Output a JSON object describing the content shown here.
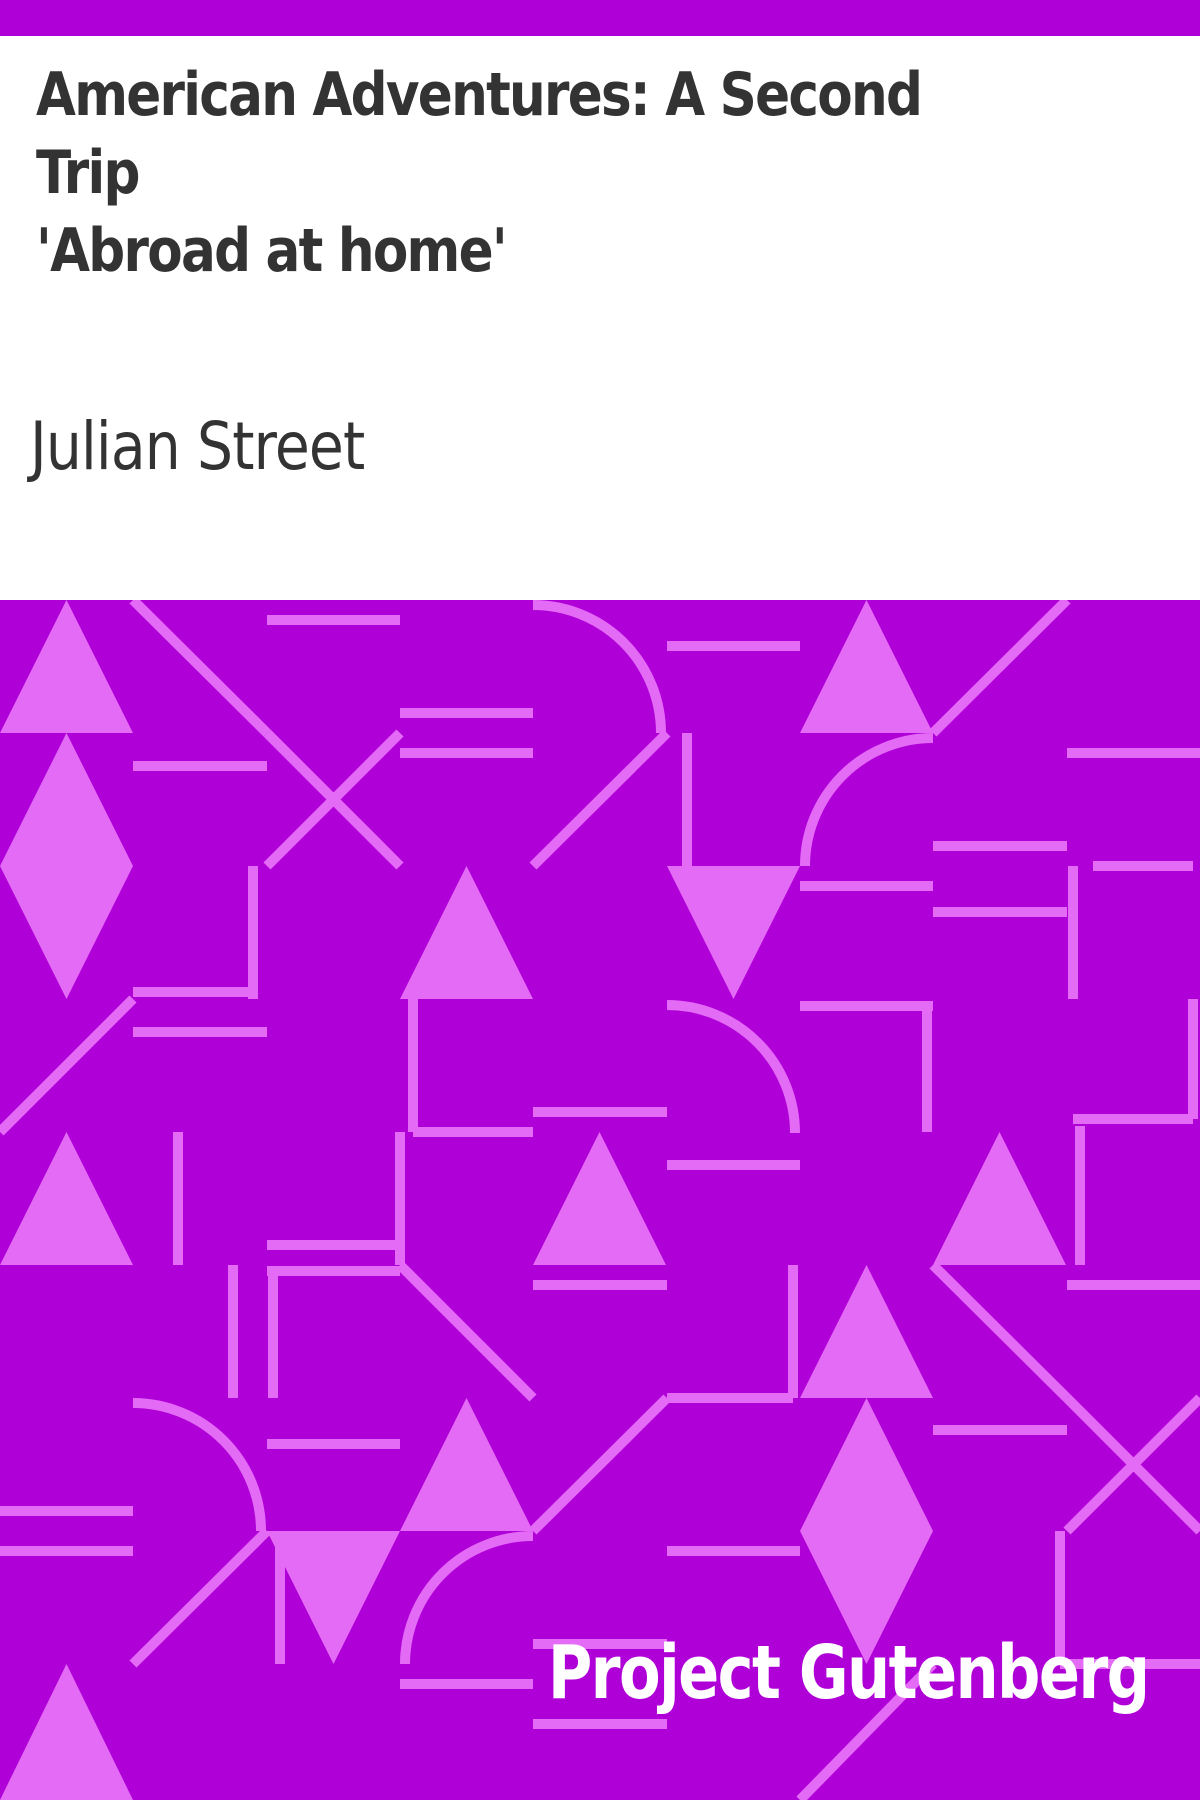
{
  "book": {
    "title_lines": [
      "American Adventures: A Second Trip",
      "'Abroad at home'"
    ],
    "author": "Julian Street",
    "publisher": "Project Gutenberg"
  },
  "colors": {
    "background": "#b000d8",
    "pattern": "#e46bf6",
    "text_dark": "#333333",
    "text_light": "#ffffff"
  }
}
